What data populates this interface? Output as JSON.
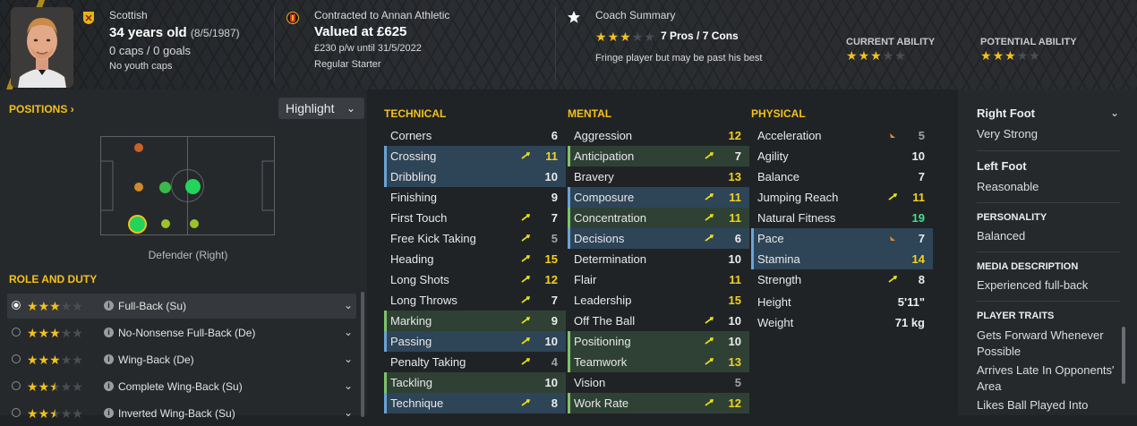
{
  "header": {
    "nationality": "Scottish",
    "age": "34 years old",
    "dob": "(8/5/1987)",
    "caps_goals": "0 caps / 0 goals",
    "youth_caps": "No youth caps",
    "contract": "Contracted to Annan Athletic",
    "value": "Valued at £625",
    "wage": "£230 p/w until 31/5/2022",
    "squad_status": "Regular Starter",
    "coach_summary_title": "Coach Summary",
    "pros_cons": "7 Pros / 7 Cons",
    "coach_note": "Fringe player but may be past his best",
    "coach_stars": 3,
    "current_ability_label": "CURRENT ABILITY",
    "current_ability_stars": 3,
    "potential_ability_label": "POTENTIAL ABILITY",
    "potential_ability_stars": 3
  },
  "positions": {
    "title": "POSITIONS",
    "title_chevron": "›",
    "highlight_label": "Highlight",
    "position_label": "Defender (Right)"
  },
  "role_duty": {
    "title": "ROLE AND DUTY",
    "roles": [
      {
        "label": "Full-Back (Su)",
        "stars": 3,
        "active": true
      },
      {
        "label": "No-Nonsense Full-Back (De)",
        "stars": 3,
        "active": false
      },
      {
        "label": "Wing-Back (De)",
        "stars": 3,
        "active": false
      },
      {
        "label": "Complete Wing-Back (Su)",
        "stars": 2.5,
        "active": false
      },
      {
        "label": "Inverted Wing-Back (Su)",
        "stars": 2.5,
        "active": false
      }
    ]
  },
  "technical": {
    "title": "TECHNICAL",
    "attributes": [
      {
        "name": "Corners",
        "value": "6"
      },
      {
        "name": "Crossing",
        "value": "11"
      },
      {
        "name": "Dribbling",
        "value": "10"
      },
      {
        "name": "Finishing",
        "value": "9"
      },
      {
        "name": "First Touch",
        "value": "7"
      },
      {
        "name": "Free Kick Taking",
        "value": "5"
      },
      {
        "name": "Heading",
        "value": "15"
      },
      {
        "name": "Long Shots",
        "value": "12"
      },
      {
        "name": "Long Throws",
        "value": "7"
      },
      {
        "name": "Marking",
        "value": "9"
      },
      {
        "name": "Passing",
        "value": "10"
      },
      {
        "name": "Penalty Taking",
        "value": "4"
      },
      {
        "name": "Tackling",
        "value": "10"
      },
      {
        "name": "Technique",
        "value": "8"
      }
    ]
  },
  "mental": {
    "title": "MENTAL",
    "attributes": [
      {
        "name": "Aggression",
        "value": "12"
      },
      {
        "name": "Anticipation",
        "value": "7"
      },
      {
        "name": "Bravery",
        "value": "13"
      },
      {
        "name": "Composure",
        "value": "11"
      },
      {
        "name": "Concentration",
        "value": "11"
      },
      {
        "name": "Decisions",
        "value": "6"
      },
      {
        "name": "Determination",
        "value": "10"
      },
      {
        "name": "Flair",
        "value": "11"
      },
      {
        "name": "Leadership",
        "value": "15"
      },
      {
        "name": "Off The Ball",
        "value": "10"
      },
      {
        "name": "Positioning",
        "value": "10"
      },
      {
        "name": "Teamwork",
        "value": "13"
      },
      {
        "name": "Vision",
        "value": "5"
      },
      {
        "name": "Work Rate",
        "value": "12"
      }
    ]
  },
  "physical": {
    "title": "PHYSICAL",
    "attributes": [
      {
        "name": "Acceleration",
        "value": "5"
      },
      {
        "name": "Agility",
        "value": "10"
      },
      {
        "name": "Balance",
        "value": "7"
      },
      {
        "name": "Jumping Reach",
        "value": "11"
      },
      {
        "name": "Natural Fitness",
        "value": "19"
      },
      {
        "name": "Pace",
        "value": "7"
      },
      {
        "name": "Stamina",
        "value": "14"
      },
      {
        "name": "Strength",
        "value": "8"
      }
    ],
    "height_label": "Height",
    "height": "5'11\"",
    "weight_label": "Weight",
    "weight": "71 kg"
  },
  "details": {
    "right_foot_label": "Right Foot",
    "right_foot": "Very Strong",
    "left_foot_label": "Left Foot",
    "left_foot": "Reasonable",
    "personality_label": "PERSONALITY",
    "personality": "Balanced",
    "media_label": "MEDIA DESCRIPTION",
    "media": "Experienced full-back",
    "traits_label": "PLAYER TRAITS",
    "traits": [
      "Gets Forward Whenever Possible",
      "Arrives Late In Opponents' Area",
      "Likes Ball Played Into"
    ]
  },
  "colors": {
    "accent": "#f2c11e",
    "hl_blue": "#2e4457",
    "hl_green": "#2f4135",
    "background": "#202326"
  }
}
